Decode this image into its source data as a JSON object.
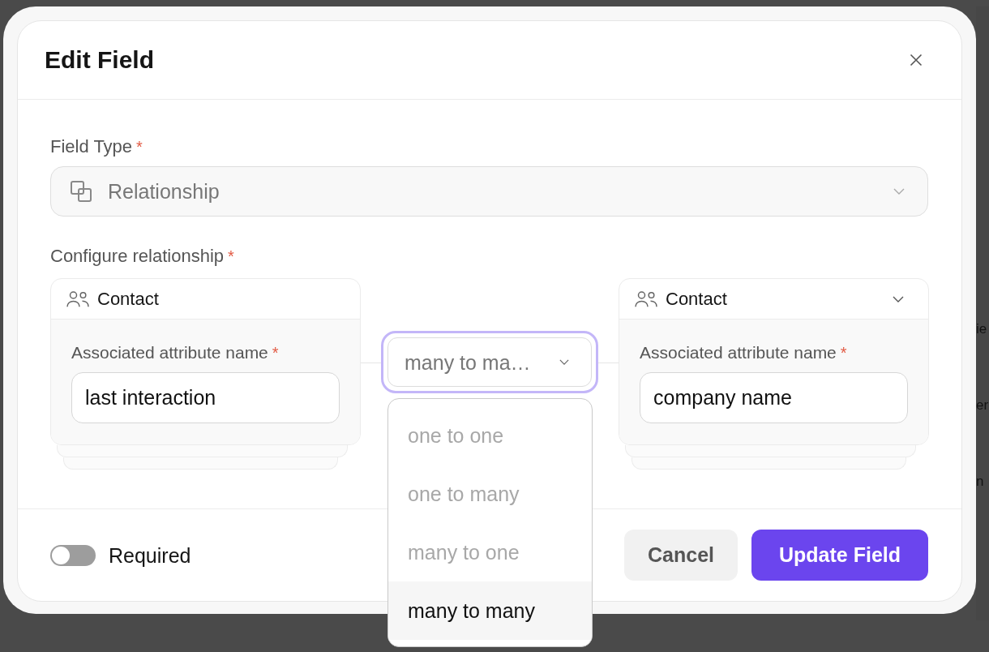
{
  "dialog": {
    "title": "Edit Field"
  },
  "field_type": {
    "label": "Field Type",
    "required_mark": "*",
    "value": "Relationship",
    "disabled": true
  },
  "configure": {
    "label": "Configure relationship",
    "required_mark": "*"
  },
  "left_entity": {
    "entity": "Contact",
    "dropdown": false,
    "attribute_label": "Associated attribute name",
    "required_mark": "*",
    "attribute_value": "last interaction"
  },
  "cardinality": {
    "value": "many to ma…",
    "focused": true,
    "expanded": true,
    "options": [
      {
        "label": "one to one",
        "selected": false
      },
      {
        "label": "one to many",
        "selected": false
      },
      {
        "label": "many to one",
        "selected": false
      },
      {
        "label": "many to many",
        "selected": true
      }
    ]
  },
  "right_entity": {
    "entity": "Contact",
    "dropdown": true,
    "attribute_label": "Associated attribute name",
    "required_mark": "*",
    "attribute_value": "company name"
  },
  "footer": {
    "toggle": {
      "label": "Required",
      "on": false
    },
    "buttons": [
      {
        "label": "Cancel",
        "kind": "cancel"
      },
      {
        "label": "Update Field",
        "kind": "submit"
      }
    ]
  },
  "background": {
    "fragments": [
      "ie",
      "er",
      "n"
    ]
  }
}
